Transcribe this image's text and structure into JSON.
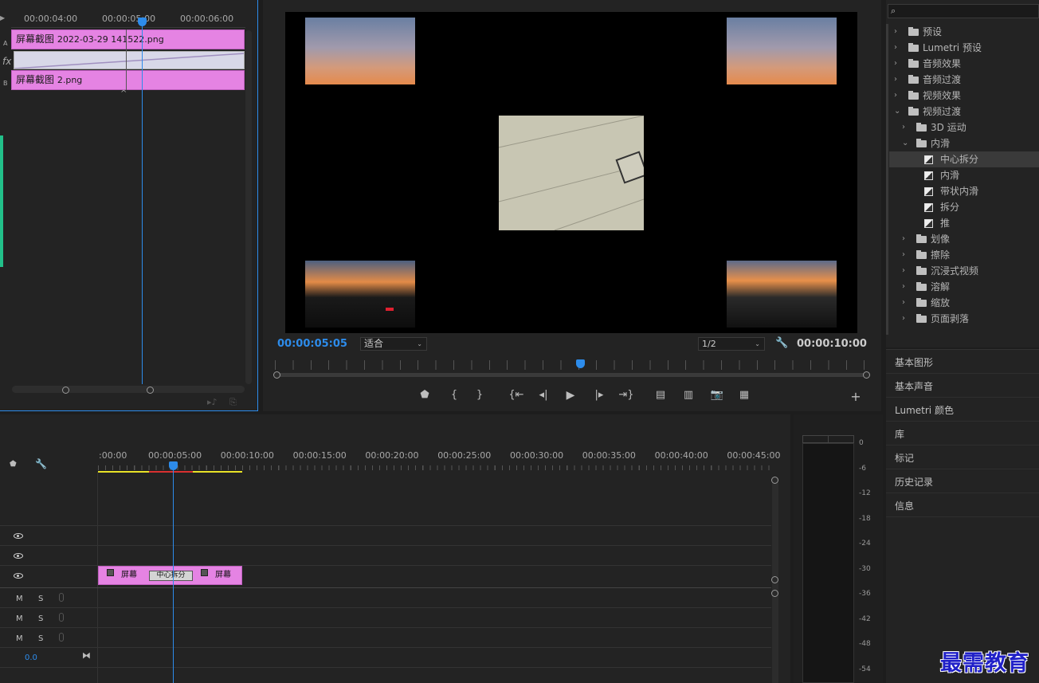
{
  "source_panel": {
    "ruler": [
      "00:00:04:00",
      "00:00:05:00",
      "00:00:06:00"
    ],
    "track_a_label": "A",
    "track_b_label": "B",
    "fx_label": "fx",
    "clip_a_name": "屏幕截图",
    "clip_a_suffix": "2022-03-29  141522.png",
    "clip_b_name": "屏幕截图",
    "clip_b_suffix": "2.png"
  },
  "program_monitor": {
    "timecode": "00:00:05:05",
    "fit_select": "适合",
    "resolution_select": "1/2",
    "duration": "00:00:10:00",
    "controls": [
      "marker",
      "mark-in",
      "mark-out",
      "go-to-in",
      "step-back",
      "play",
      "step-forward",
      "go-to-out",
      "lift",
      "extract",
      "export-frame",
      "compare"
    ]
  },
  "effects_panel": {
    "search_placeholder": "",
    "tree": [
      {
        "label": "预设",
        "kind": "preset",
        "expanded": false,
        "level": 0
      },
      {
        "label": "Lumetri 预设",
        "kind": "preset",
        "expanded": false,
        "level": 0
      },
      {
        "label": "音频效果",
        "kind": "folder",
        "expanded": false,
        "level": 0
      },
      {
        "label": "音频过渡",
        "kind": "folder",
        "expanded": false,
        "level": 0
      },
      {
        "label": "视频效果",
        "kind": "folder",
        "expanded": false,
        "level": 0
      },
      {
        "label": "视频过渡",
        "kind": "folder",
        "expanded": true,
        "level": 0
      },
      {
        "label": "3D 运动",
        "kind": "folder",
        "expanded": false,
        "level": 1
      },
      {
        "label": "内滑",
        "kind": "folder",
        "expanded": true,
        "level": 1
      },
      {
        "label": "中心拆分",
        "kind": "transition",
        "level": 2,
        "selected": true
      },
      {
        "label": "内滑",
        "kind": "transition",
        "level": 2
      },
      {
        "label": "带状内滑",
        "kind": "transition",
        "level": 2
      },
      {
        "label": "拆分",
        "kind": "transition",
        "level": 2
      },
      {
        "label": "推",
        "kind": "transition",
        "level": 2
      },
      {
        "label": "划像",
        "kind": "folder",
        "expanded": false,
        "level": 1
      },
      {
        "label": "擦除",
        "kind": "folder",
        "expanded": false,
        "level": 1
      },
      {
        "label": "沉浸式视频",
        "kind": "folder",
        "expanded": false,
        "level": 1
      },
      {
        "label": "溶解",
        "kind": "folder",
        "expanded": false,
        "level": 1
      },
      {
        "label": "缩放",
        "kind": "folder",
        "expanded": false,
        "level": 1
      },
      {
        "label": "页面剥落",
        "kind": "folder",
        "expanded": false,
        "level": 1
      }
    ]
  },
  "side_panels": [
    "基本图形",
    "基本声音",
    "Lumetri 颜色",
    "库",
    "标记",
    "历史记录",
    "信息"
  ],
  "timeline": {
    "ruler": [
      ":00:00",
      "00:00:05:00",
      "00:00:10:00",
      "00:00:15:00",
      "00:00:20:00",
      "00:00:25:00",
      "00:00:30:00",
      "00:00:35:00",
      "00:00:40:00",
      "00:00:45:00"
    ],
    "clip_left_label": "屏幕",
    "transition_label": "中心拆分",
    "clip_right_label": "屏幕",
    "audio_m": "M",
    "audio_s": "S",
    "master_value": "0.0"
  },
  "audio_meter": {
    "scale": [
      "0",
      "-6",
      "-12",
      "-18",
      "-24",
      "-30",
      "-36",
      "-42",
      "-48",
      "-54"
    ]
  },
  "watermark": "最需教育",
  "colors": {
    "clip": "#e583e3",
    "playhead": "#2d8ceb",
    "timecode": "#2d8ceb",
    "work_area": "#e8e227",
    "render_red": "#d93030"
  }
}
